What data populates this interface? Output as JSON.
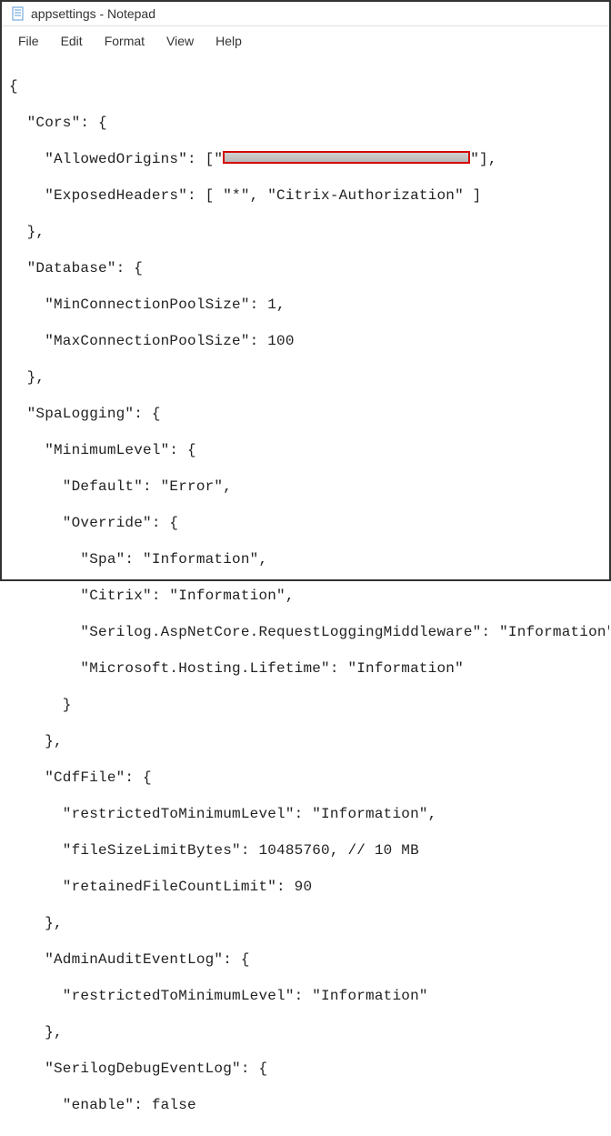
{
  "titlebar": {
    "title": "appsettings - Notepad"
  },
  "menubar": {
    "file": "File",
    "edit": "Edit",
    "format": "Format",
    "view": "View",
    "help": "Help"
  },
  "editor": {
    "lines": {
      "l1": "{",
      "l2": "  \"Cors\": {",
      "l3a": "    \"AllowedOrigins\": [\"",
      "l3b": "\"],",
      "l4": "    \"ExposedHeaders\": [ \"*\", \"Citrix-Authorization\" ]",
      "l5": "  },",
      "l6": "  \"Database\": {",
      "l7": "    \"MinConnectionPoolSize\": 1,",
      "l8": "    \"MaxConnectionPoolSize\": 100",
      "l9": "  },",
      "l10": "  \"SpaLogging\": {",
      "l11": "    \"MinimumLevel\": {",
      "l12": "      \"Default\": \"Error\",",
      "l13": "      \"Override\": {",
      "l14": "        \"Spa\": \"Information\",",
      "l15": "        \"Citrix\": \"Information\",",
      "l16": "        \"Serilog.AspNetCore.RequestLoggingMiddleware\": \"Information\",",
      "l17": "        \"Microsoft.Hosting.Lifetime\": \"Information\"",
      "l18": "      }",
      "l19": "    },",
      "l20": "    \"CdfFile\": {",
      "l21": "      \"restrictedToMinimumLevel\": \"Information\",",
      "l22": "      \"fileSizeLimitBytes\": 10485760, // 10 MB",
      "l23": "      \"retainedFileCountLimit\": 90",
      "l24": "    },",
      "l25": "    \"AdminAuditEventLog\": {",
      "l26": "      \"restrictedToMinimumLevel\": \"Information\"",
      "l27": "    },",
      "l28": "    \"SerilogDebugEventLog\": {",
      "l29": "      \"enable\": false"
    }
  }
}
